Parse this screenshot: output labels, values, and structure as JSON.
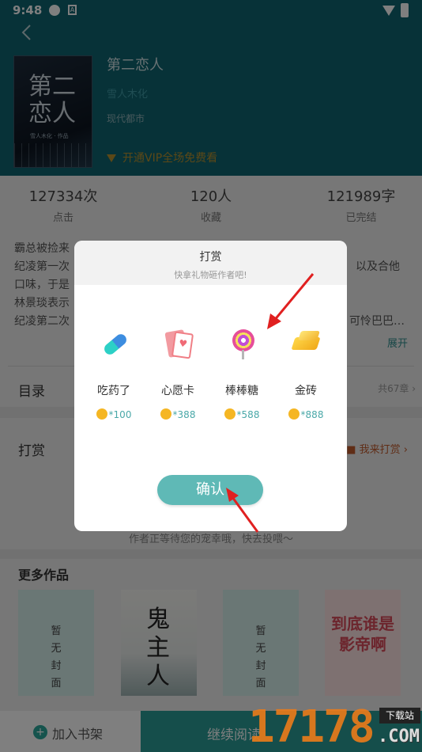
{
  "status_bar": {
    "time": "9:48",
    "sim_icon": "A"
  },
  "header": {
    "back_icon": "chevron-left-icon"
  },
  "book": {
    "cover_title": "第二恋人",
    "cover_subtitle": "雪人木化 · 作品",
    "title": "第二恋人",
    "author": "雪人木化",
    "genre": "现代都市",
    "vip_text": "开通VIP全场免费看"
  },
  "stats": [
    {
      "value": "127334次",
      "label": "点击"
    },
    {
      "value": "120人",
      "label": "收藏"
    },
    {
      "value": "121989字",
      "label": "已完结"
    }
  ],
  "intro": {
    "line1": "霸总被捡来",
    "line2a": "纪凌第一次",
    "line2b": "以及合他",
    "line3": "口味，于是",
    "line4": "林景琰表示",
    "line5a": "纪凌第二次",
    "line5b": "可怜巴巴…",
    "expand": "展开"
  },
  "toc": {
    "title": "目录",
    "count": "共67章"
  },
  "reward_section": {
    "title": "打赏",
    "link": "我来打赏",
    "waiting": "作者正等待您的宠幸哦，快去投喂～"
  },
  "more_works": {
    "title": "更多作品",
    "no_cover": [
      "暂",
      "无",
      "封",
      "面"
    ],
    "book2_title": "鬼主人",
    "book4_title": "到底谁是影帝啊"
  },
  "bottom_bar": {
    "add_shelf": "加入书架",
    "continue": "继续阅读"
  },
  "modal": {
    "title": "打赏",
    "subtitle": "快拿礼物砸作者吧!",
    "gifts": [
      {
        "name": "吃药了",
        "price": "*100"
      },
      {
        "name": "心愿卡",
        "price": "*388"
      },
      {
        "name": "棒棒糖",
        "price": "*588"
      },
      {
        "name": "金砖",
        "price": "*888"
      }
    ],
    "confirm": "确认"
  },
  "watermark": {
    "number": "17178",
    "badge": "下载站",
    "domain": ".COM"
  },
  "colors": {
    "teal": "#2a9d96",
    "header": "#0f6470",
    "arrow": "#e02020",
    "coin": "#f5b623"
  }
}
